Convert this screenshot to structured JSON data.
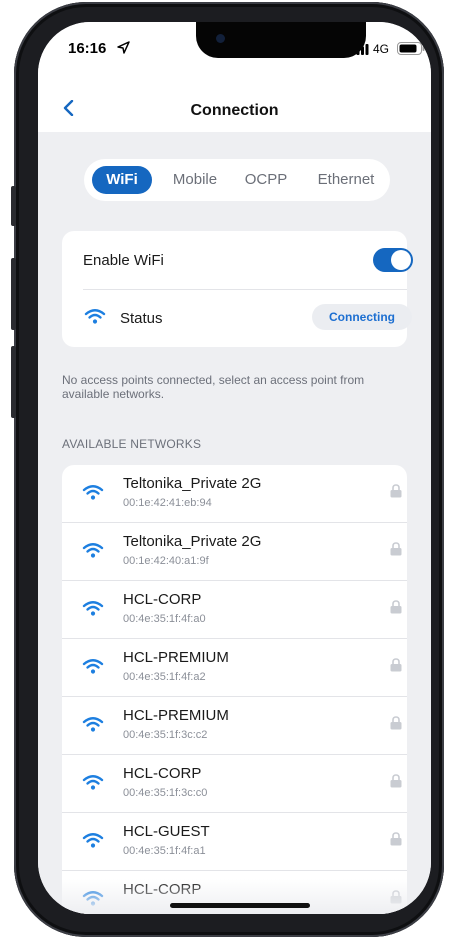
{
  "status_bar": {
    "time": "16:16",
    "network": "4G",
    "icons": [
      "location-arrow-icon",
      "cellular-signal-icon",
      "battery-icon"
    ]
  },
  "nav": {
    "title": "Connection",
    "back_icon": "chevron-left-icon"
  },
  "tabs": [
    {
      "label": "WiFi",
      "active": true
    },
    {
      "label": "Mobile",
      "active": false
    },
    {
      "label": "OCPP",
      "active": false
    },
    {
      "label": "Ethernet",
      "active": false
    }
  ],
  "wifi_settings": {
    "enable_label": "Enable WiFi",
    "enabled": true,
    "status_label": "Status",
    "status_value": "Connecting"
  },
  "info_text": "No access points connected, select an access point from available networks.",
  "networks_header": "AVAILABLE NETWORKS",
  "networks": [
    {
      "name": "Teltonika_Private 2G",
      "mac": "00:1e:42:41:eb:94"
    },
    {
      "name": "Teltonika_Private 2G",
      "mac": "00:1e:42:40:a1:9f"
    },
    {
      "name": "HCL-CORP",
      "mac": "00:4e:35:1f:4f:a0"
    },
    {
      "name": "HCL-PREMIUM",
      "mac": "00:4e:35:1f:4f:a2"
    },
    {
      "name": "HCL-PREMIUM",
      "mac": "00:4e:35:1f:3c:c2"
    },
    {
      "name": "HCL-CORP",
      "mac": "00:4e:35:1f:3c:c0"
    },
    {
      "name": "HCL-GUEST",
      "mac": "00:4e:35:1f:4f:a1"
    },
    {
      "name": "HCL-CORP",
      "mac": ""
    }
  ],
  "colors": {
    "accent": "#1567c0",
    "wifi_icon": "#1d7fe0",
    "background": "#eeeff2",
    "lock": "#c9ccd2"
  }
}
